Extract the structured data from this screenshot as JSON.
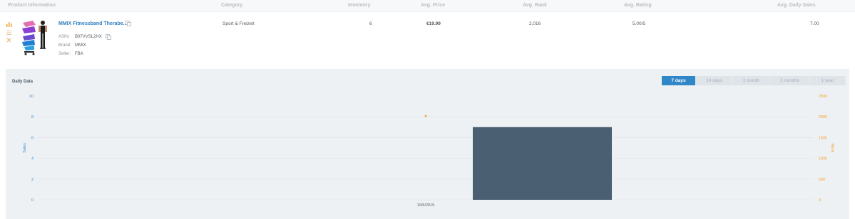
{
  "header": {
    "product_information": "Product Information",
    "category": "Category",
    "inventory": "Inventory",
    "avg_price": "Avg. Price",
    "avg_rank": "Avg. Rank",
    "avg_rating": "Avg. Rating",
    "avg_daily_sales": "Avg. Daily Sales"
  },
  "product": {
    "title": "MMIX Fitnessband Therabe...",
    "asin_label": "ASIN:",
    "asin": "B07VVSL2HX",
    "brand_label": "Brand:",
    "brand": "MMIX",
    "seller_label": "Seller:",
    "seller": "FBA",
    "category": "Sport & Freizeit",
    "inventory": "6",
    "avg_price": "€19.99",
    "avg_rank": "2,016",
    "avg_rating": "5.00/5",
    "avg_daily_sales": "7.00"
  },
  "side_icons": [
    "chart-icon",
    "list-icon",
    "x-icon"
  ],
  "panel": {
    "title": "Daily Data",
    "tabs": [
      {
        "label": "7 days",
        "active": true
      },
      {
        "label": "14 days",
        "active": false
      },
      {
        "label": "1 month",
        "active": false
      },
      {
        "label": "2 months",
        "active": false
      },
      {
        "label": "1 year",
        "active": false
      }
    ]
  },
  "colors": {
    "accent": "#2f87c8",
    "bar": "#4a5f71",
    "rank_point": "#f0a32b",
    "left_axis": "#3d8fd1",
    "right_axis": "#f0a32b"
  },
  "chart_data": {
    "type": "bar",
    "categories": [
      "10/6/2019"
    ],
    "series": [
      {
        "name": "Sales",
        "type": "bar",
        "axis": "left",
        "values": [
          7
        ]
      },
      {
        "name": "Rank",
        "type": "scatter",
        "axis": "right",
        "values": [
          2016
        ]
      }
    ],
    "xlabel": "",
    "ylabel": "Sales",
    "y2label": "Rank",
    "ylim": [
      0,
      10
    ],
    "y_ticks": [
      0,
      2,
      4,
      6,
      8,
      10
    ],
    "y2lim": [
      0,
      2500
    ],
    "y2_ticks": [
      0,
      500,
      1000,
      1500,
      2000,
      2500
    ],
    "grid": true
  }
}
